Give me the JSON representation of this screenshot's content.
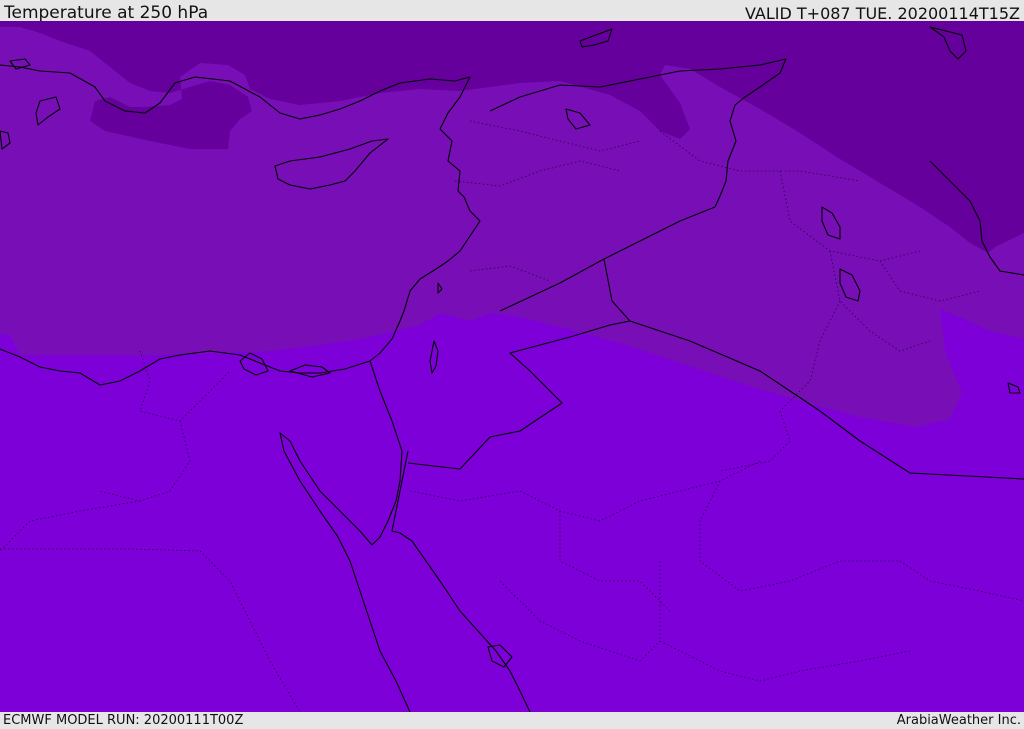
{
  "header": {
    "title": "Temperature at 250 hPa",
    "valid_time": "VALID T+087 TUE. 20200114T15Z"
  },
  "footer": {
    "model_run": "ECMWF MODEL RUN: 20200111T00Z",
    "credit": "ArabiaWeather Inc."
  },
  "map": {
    "colors": {
      "band_cold": "#65009c",
      "band_mid": "#780fb6",
      "band_warm": "#7d00d8",
      "coastline": "#000000"
    }
  }
}
